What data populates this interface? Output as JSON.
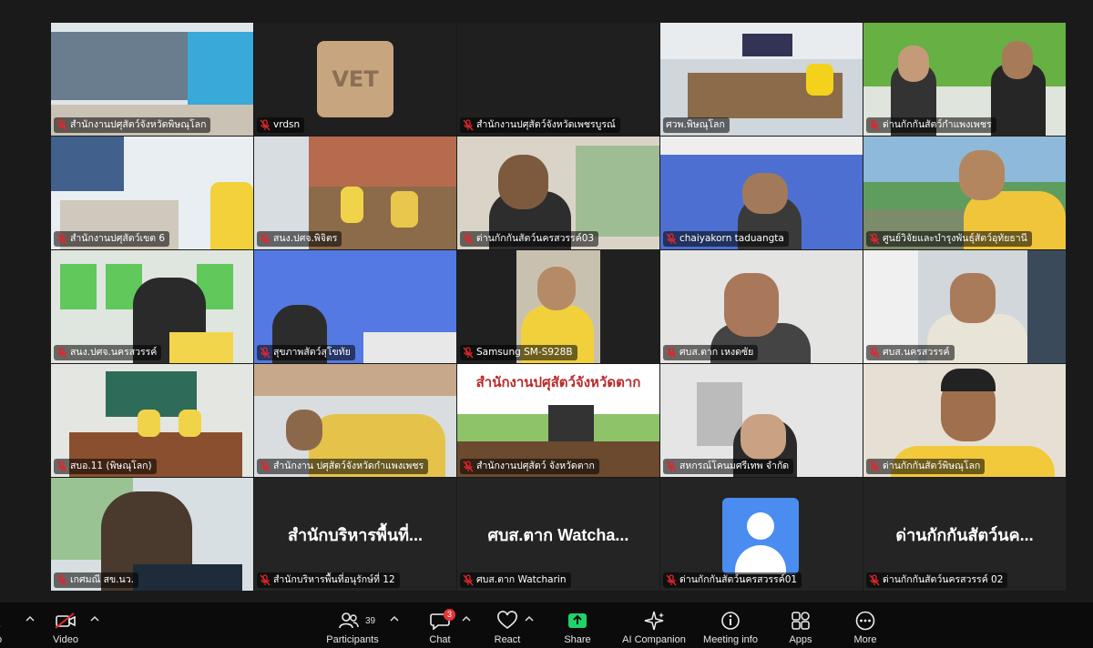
{
  "meeting": {
    "tiles": [
      {
        "name": "สำนักงานปศุสัตว์จังหวัดพิษณุโลก",
        "muted": true,
        "scene": "office-banner"
      },
      {
        "name": "vrdsn",
        "muted": true,
        "scene": "logo-vet",
        "logo_text": "VET"
      },
      {
        "name": "สำนักงานปศุสัตว์จังหวัดเพชรบูรณ์",
        "muted": true,
        "scene": "blank"
      },
      {
        "name": "ศวพ.พิษณุโลก",
        "muted": false,
        "scene": "conference-room",
        "active": true
      },
      {
        "name": "ด่านกักกันสัตว์กำแพงเพชร",
        "muted": true,
        "scene": "two-people-green"
      },
      {
        "name": "สำนักงานปศุสัตว์เขต 6",
        "muted": true,
        "scene": "office-room"
      },
      {
        "name": "สนง.ปศจ.พิจิตร",
        "muted": true,
        "scene": "meeting-red-curtain"
      },
      {
        "name": "ด่านกักกันสัตว์นครสวรรค์03",
        "muted": true,
        "scene": "woman-glasses"
      },
      {
        "name": "chaiyakorn taduangta",
        "muted": true,
        "scene": "blue-curtain-man"
      },
      {
        "name": "ศูนย์วิจัยและบำรุงพันธุ์สัตว์อุทัยธานี",
        "muted": true,
        "scene": "outdoor-man"
      },
      {
        "name": "สนง.ปศจ.นครสวรรค์",
        "muted": true,
        "scene": "green-window-woman"
      },
      {
        "name": "สุขภาพสัตว์สุโขทัย",
        "muted": true,
        "scene": "blue-curtain-woman"
      },
      {
        "name": "Samsung SM-S928B",
        "muted": true,
        "scene": "phone-woman"
      },
      {
        "name": "ศบส.ตาก เหงดซัย",
        "muted": true,
        "scene": "white-wall-man"
      },
      {
        "name": "ศบส.นครสวรรค์",
        "muted": true,
        "scene": "uniform-man"
      },
      {
        "name": "สบอ.11 (พิษณุโลก)",
        "muted": true,
        "scene": "meeting-table"
      },
      {
        "name": "สำนักงาน ปศุสัตว์จังหวัดกำแพงเพชร",
        "muted": true,
        "scene": "yellow-shirt-bending"
      },
      {
        "name": "สำนักงานปศุสัตว์ จังหวัดตาก",
        "muted": true,
        "scene": "tak-banner",
        "banner_text": "สำนักงานปศุสัตว์จังหวัดตาก"
      },
      {
        "name": "สหกรณ์โคนมศรีเทพ จำกัด",
        "muted": true,
        "scene": "office-woman"
      },
      {
        "name": "ด่านกักกันสัตว์พิษณุโลก",
        "muted": true,
        "scene": "yellow-shirt-man"
      },
      {
        "name": "เกศมณี สข.นว.",
        "muted": true,
        "scene": "woman-dark-hair"
      },
      {
        "name": "สำนักบริหารพื้นที่อนุรักษ์ที่ 12",
        "muted": true,
        "scene": "name-only",
        "display_name": "สำนักบริหารพื้นที่..."
      },
      {
        "name": "ศบส.ตาก Watcharin",
        "muted": true,
        "scene": "name-only",
        "display_name": "ศบส.ตาก Watcha..."
      },
      {
        "name": "ด่านกักกันสัตว์นครสวรรค์01",
        "muted": true,
        "scene": "avatar-placeholder"
      },
      {
        "name": "ด่านกักกันสัตว์นครสวรรค์ 02",
        "muted": true,
        "scene": "name-only",
        "display_name": "ด่านกักกันสัตว์นค..."
      }
    ]
  },
  "toolbar": {
    "audio_label": "o",
    "video_label": "Video",
    "participants_label": "Participants",
    "participants_count": "39",
    "chat_label": "Chat",
    "chat_badge": "3",
    "react_label": "React",
    "share_label": "Share",
    "ai_label": "AI Companion",
    "meeting_info_label": "Meeting info",
    "apps_label": "Apps",
    "more_label": "More"
  },
  "colors": {
    "background": "#1a1a1a",
    "toolbar": "#0b0b0b",
    "active_speaker": "#27c46a",
    "share_green": "#1fd36b",
    "badge_red": "#e8343a",
    "muted_red": "#e0262d"
  }
}
